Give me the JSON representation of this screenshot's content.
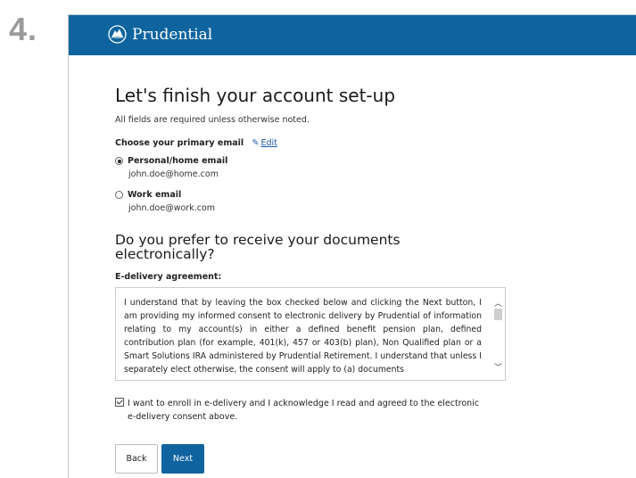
{
  "step_number": "4.",
  "brand": {
    "name": "Prudential",
    "logo_icon": "rock-logo-icon",
    "header_color": "#0f649f"
  },
  "form": {
    "title": "Let's finish your account set-up",
    "note": "All fields are required unless otherwise noted.",
    "email_choice": {
      "label": "Choose your primary email",
      "edit_label": "Edit",
      "edit_icon": "pencil-icon",
      "options": [
        {
          "label": "Personal/home email",
          "value": "john.doe@home.com",
          "selected": true
        },
        {
          "label": "Work email",
          "value": "john.doe@work.com",
          "selected": false
        }
      ]
    },
    "edelivery": {
      "heading": "Do you prefer to receive your documents electronically?",
      "agreement_label": "E-delivery agreement:",
      "agreement_text": "I understand that by leaving the box checked below and clicking the Next button, I am providing my informed consent to electronic delivery by Prudential of information relating to my account(s) in either a defined benefit pension plan, defined contribution plan (for example, 401(k), 457 or 403(b) plan), Non Qualified plan or a Smart Solutions IRA administered by Prudential Retirement. I understand that unless I separately elect otherwise, the consent will apply to (a) documents",
      "consent_line1": "I want to enroll in e-delivery and I acknowledge I read and agreed to the electronic",
      "consent_line2": "e-delivery consent above.",
      "consent_checked": true
    },
    "buttons": {
      "back": "Back",
      "next": "Next"
    }
  }
}
